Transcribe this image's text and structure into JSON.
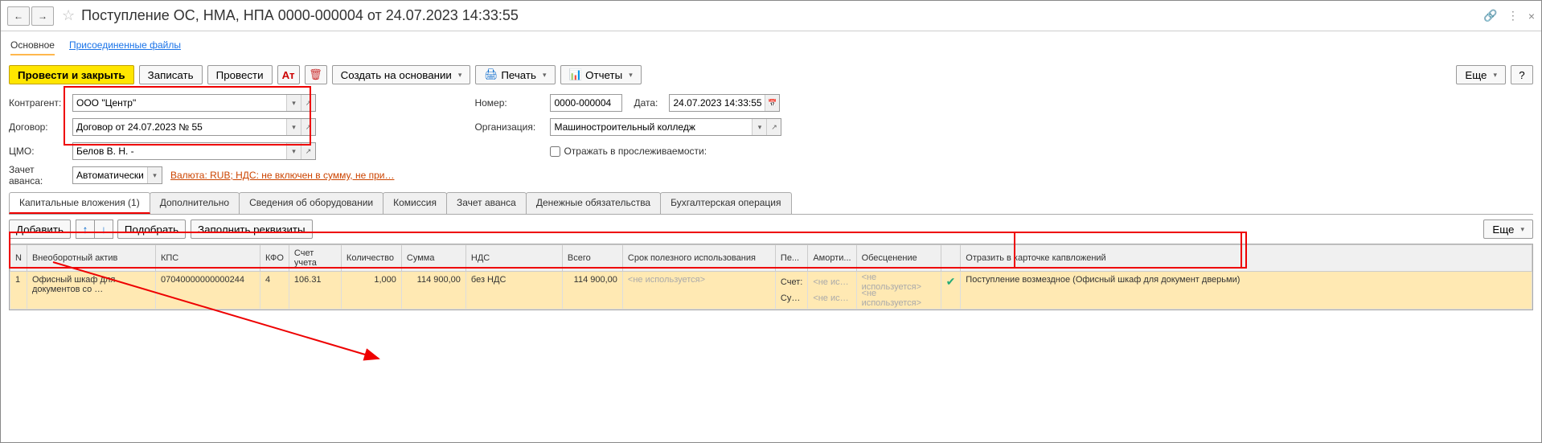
{
  "header": {
    "title": "Поступление ОС, НМА, НПА 0000-000004 от 24.07.2023 14:33:55"
  },
  "subtabs": {
    "main": "Основное",
    "attached": "Присоединенные файлы"
  },
  "toolbar": {
    "post_close": "Провести и закрыть",
    "save": "Записать",
    "post": "Провести",
    "create_based": "Создать на основании",
    "print": "Печать",
    "reports": "Отчеты",
    "more": "Еще"
  },
  "form": {
    "counterparty_label": "Контрагент:",
    "counterparty_value": "ООО \"Центр\"",
    "contract_label": "Договор:",
    "contract_value": "Договор от 24.07.2023 № 55",
    "cmo_label": "ЦМО:",
    "cmo_value": "Белов В. Н. -",
    "advance_label": "Зачет аванса:",
    "advance_value": "Автоматически",
    "currency_link": "Валюта: RUB; НДС: не включен в сумму, не при…",
    "number_label": "Номер:",
    "number_value": "0000-000004",
    "date_label": "Дата:",
    "date_value": "24.07.2023 14:33:55",
    "org_label": "Организация:",
    "org_value": "Машиностроительный колледж",
    "trace_label": "Отражать в прослеживаемости:"
  },
  "tabs": {
    "cap": "Капитальные вложения (1)",
    "extra": "Дополнительно",
    "equip": "Сведения об оборудовании",
    "commission": "Комиссия",
    "advance": "Зачет аванса",
    "obligations": "Денежные обязательства",
    "accounting": "Бухгалтерская операция"
  },
  "table_toolbar": {
    "add": "Добавить",
    "pick": "Подобрать",
    "fill": "Заполнить реквизиты",
    "more": "Еще"
  },
  "table": {
    "headers": {
      "n": "N",
      "asset": "Внеоборотный актив",
      "kps": "КПС",
      "kfo": "КФО",
      "account": "Счет учета",
      "qty": "Количество",
      "sum": "Сумма",
      "vat": "НДС",
      "total": "Всего",
      "useful_life": "Срок полезного использования",
      "pe": "Пе...",
      "amort": "Аморти...",
      "impairment": "Обесценение",
      "reflect": "Отразить в карточке капвложений"
    },
    "row1": {
      "n": "1",
      "asset": "Офисный шкаф для документов со …",
      "kps": "07040000000000244",
      "kfo": "4",
      "account": "106.31",
      "qty": "1,000",
      "sum": "114 900,00",
      "vat": "без НДС",
      "total": "114 900,00",
      "useful_life": "<не используется>",
      "pe_line1": "Счет:",
      "pe_line2": "Су…",
      "amort_line1": "<не ис…",
      "amort_line2": "<не ис…",
      "impair_line1": "<не используется>",
      "impair_line2": "<не используется>",
      "reflect_text": "Поступление возмездное (Офисный шкаф для документ дверьми)"
    }
  }
}
